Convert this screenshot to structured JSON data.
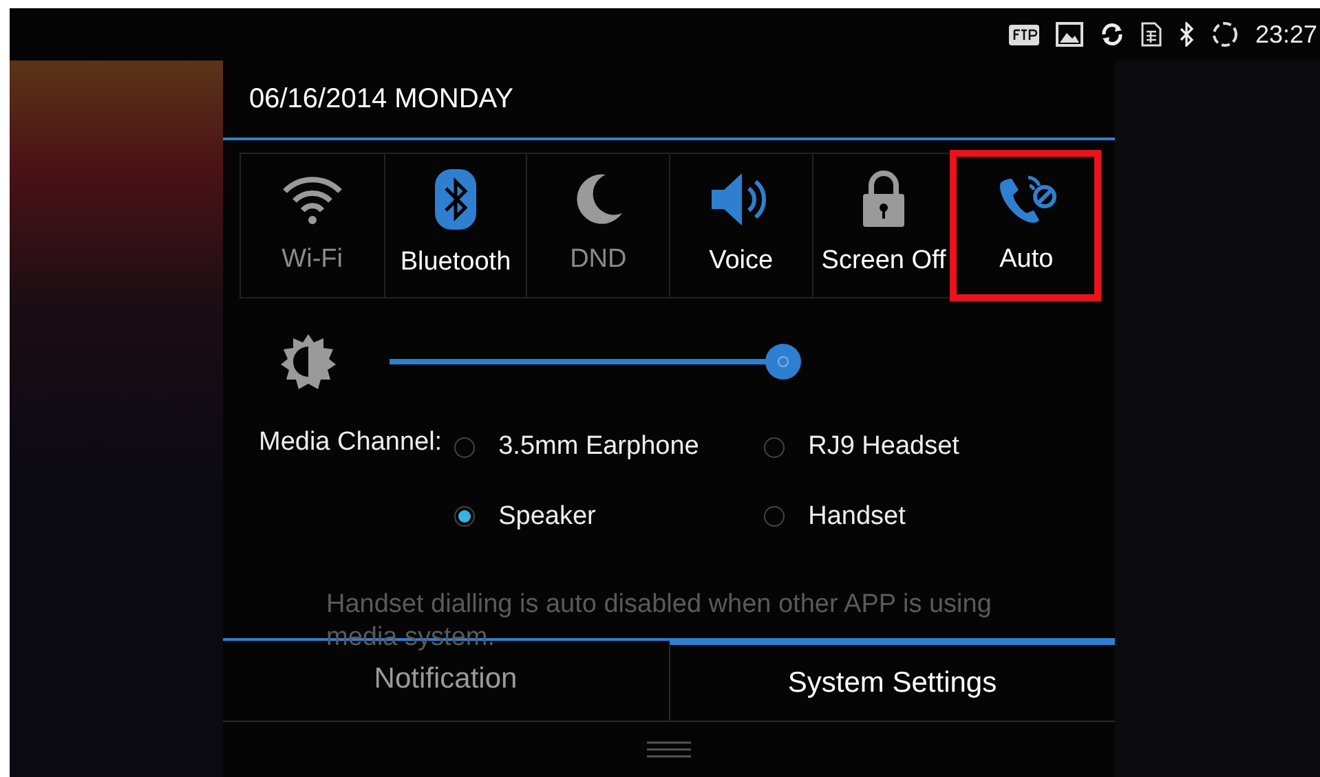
{
  "status_bar": {
    "time": "23:27"
  },
  "date": "06/16/2014 MONDAY",
  "tiles": [
    {
      "kind": "wifi",
      "label": "Wi-Fi",
      "active": false,
      "dimmed": true,
      "highlighted": false
    },
    {
      "kind": "bluetooth",
      "label": "Bluetooth",
      "active": true,
      "dimmed": false,
      "highlighted": false
    },
    {
      "kind": "dnd",
      "label": "DND",
      "active": false,
      "dimmed": true,
      "highlighted": false
    },
    {
      "kind": "voice",
      "label": "Voice",
      "active": true,
      "dimmed": false,
      "highlighted": false
    },
    {
      "kind": "lock",
      "label": "Screen Off",
      "active": false,
      "dimmed": false,
      "highlighted": false
    },
    {
      "kind": "auto",
      "label": "Auto",
      "active": true,
      "dimmed": false,
      "highlighted": true
    }
  ],
  "brightness": {
    "level": 0.96
  },
  "media_channel": {
    "label": "Media Channel:",
    "options": [
      {
        "label": "3.5mm Earphone",
        "selected": false
      },
      {
        "label": "RJ9 Headset",
        "selected": false
      },
      {
        "label": "Speaker",
        "selected": true
      },
      {
        "label": "Handset",
        "selected": false
      }
    ]
  },
  "message": "Handset dialling is auto disabled when other APP is using media system.",
  "tabs": [
    {
      "label": "Notification",
      "selected": false
    },
    {
      "label": "System Settings",
      "selected": true
    }
  ]
}
